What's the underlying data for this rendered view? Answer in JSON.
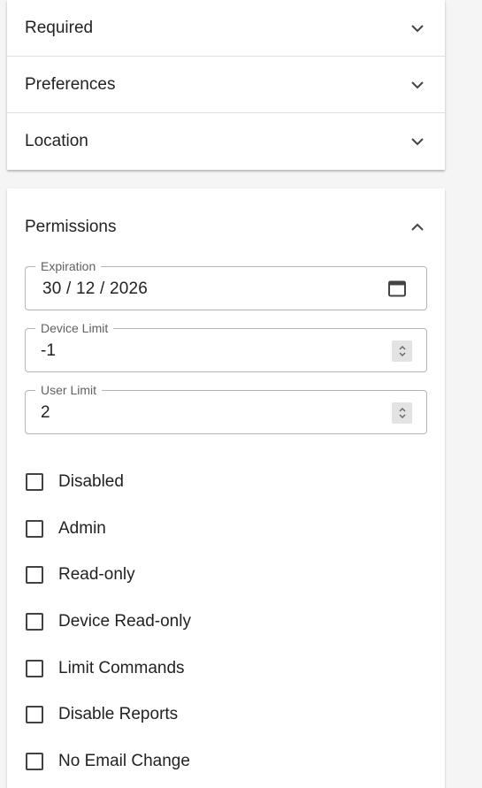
{
  "sections": {
    "required": {
      "title": "Required",
      "icon": "chevron-down-icon"
    },
    "preferences": {
      "title": "Preferences",
      "icon": "chevron-down-icon"
    },
    "location": {
      "title": "Location",
      "icon": "chevron-down-icon"
    }
  },
  "permissions": {
    "title": "Permissions",
    "icon": "chevron-up-icon",
    "expiration": {
      "label": "Expiration",
      "value": "30 / 12 / 2026",
      "icon": "calendar-icon"
    },
    "device_limit": {
      "label": "Device Limit",
      "value": "-1"
    },
    "user_limit": {
      "label": "User Limit",
      "value": "2"
    },
    "checkboxes": [
      {
        "label": "Disabled",
        "checked": false
      },
      {
        "label": "Admin",
        "checked": false
      },
      {
        "label": "Read-only",
        "checked": false
      },
      {
        "label": "Device Read-only",
        "checked": false
      },
      {
        "label": "Limit Commands",
        "checked": false
      },
      {
        "label": "Disable Reports",
        "checked": false
      },
      {
        "label": "No Email Change",
        "checked": false
      }
    ]
  },
  "colors": {
    "page_bg": "#f5f5f5",
    "card_bg": "#ffffff",
    "text": "#222222",
    "label": "#616161",
    "border": "#b5b5b5"
  }
}
